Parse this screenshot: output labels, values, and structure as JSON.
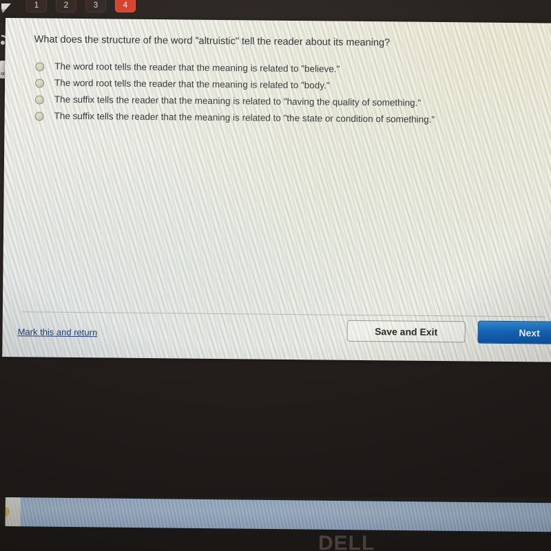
{
  "device": {
    "brand_logo": "DELL"
  },
  "topbar": {
    "tabs": [
      {
        "label": "1",
        "active": false
      },
      {
        "label": "2",
        "active": false
      },
      {
        "label": "3",
        "active": false
      },
      {
        "label": "4",
        "active": true
      }
    ]
  },
  "desktop_icons": [
    {
      "name": "pen-icon",
      "label": ""
    },
    {
      "name": "wifi-icon",
      "label": ""
    },
    {
      "name": "document-icon",
      "label": "oc"
    }
  ],
  "quiz": {
    "question": "What does the structure of the word \"altruistic\" tell the reader about its meaning?",
    "options": [
      {
        "id": "a",
        "text": "The word root tells the reader that the meaning is related to \"believe.\"",
        "selected": false
      },
      {
        "id": "b",
        "text": "The word root tells the reader that the meaning is related to \"body.\"",
        "selected": false
      },
      {
        "id": "c",
        "text": "The suffix tells the reader that the meaning is related to \"having the quality of something.\"",
        "selected": false
      },
      {
        "id": "d",
        "text": "The suffix tells the reader that the meaning is related to \"the state or condition of something.\"",
        "selected": false
      }
    ]
  },
  "footer": {
    "mark_link": "Mark this and return",
    "save_exit_label": "Save and Exit",
    "next_label": "Next"
  },
  "colors": {
    "accent_next": "#1668bf",
    "active_tab": "#d4402c",
    "link": "#1d3f7a",
    "panel_bg": "#f3f2ec",
    "bezel": "#241f1d"
  },
  "taskbar": {
    "start_label": ""
  }
}
